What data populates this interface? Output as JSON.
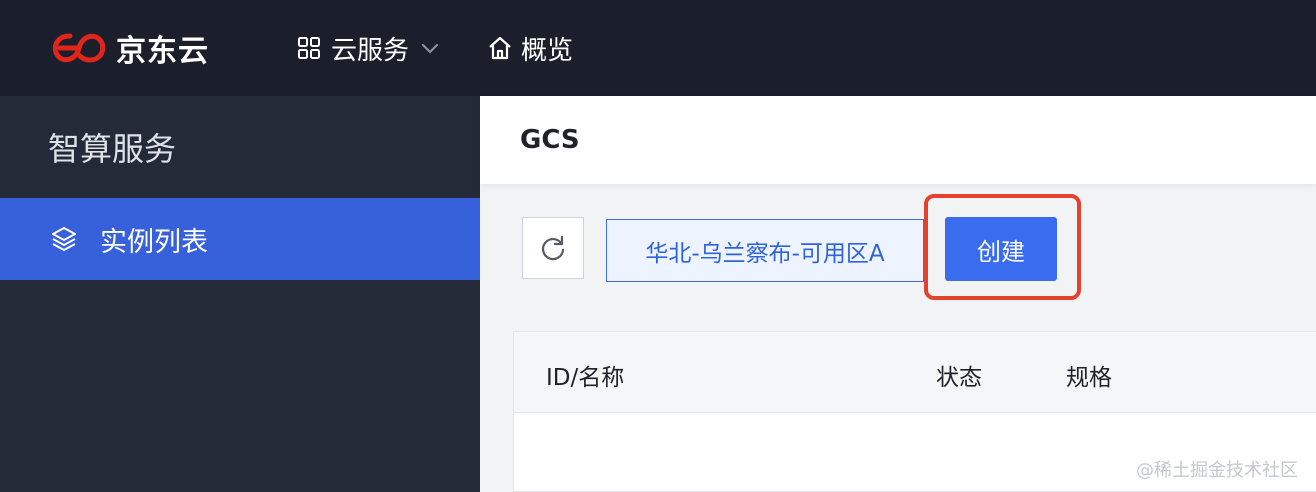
{
  "topbar": {
    "brand": "京东云",
    "nav": {
      "services_label": "云服务",
      "overview_label": "概览"
    }
  },
  "sidebar": {
    "title": "智算服务",
    "items": [
      {
        "label": "实例列表",
        "active": true
      }
    ]
  },
  "page": {
    "title": "GCS"
  },
  "toolbar": {
    "region_label": "华北-乌兰察布-可用区A",
    "create_label": "创建"
  },
  "table": {
    "columns": [
      "ID/名称",
      "状态",
      "规格"
    ],
    "rows": []
  },
  "watermark": "@稀土掘金技术社区",
  "colors": {
    "topbar_bg": "#1b1f2b",
    "sidebar_bg": "#252a38",
    "active_item": "#3760db",
    "primary": "#3a6cf0",
    "highlight": "#e4412e"
  }
}
